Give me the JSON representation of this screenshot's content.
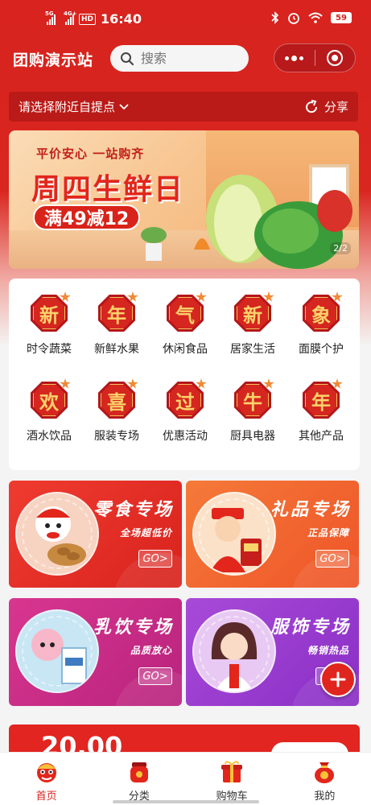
{
  "status_bar": {
    "time": "16:40",
    "signal1_label": "5G",
    "signal2_label": "4G+",
    "hd_label": "HD",
    "battery": "59"
  },
  "header": {
    "title": "团购演示站",
    "search_placeholder": "搜索"
  },
  "pickup": {
    "label": "请选择附近自提点",
    "share_label": "分享"
  },
  "banner": {
    "tagline": "平价安心 一站购齐",
    "headline": "周四生鲜日",
    "promo": "满49减12",
    "pager": "2/2"
  },
  "categories": [
    {
      "char": "新",
      "label": "时令蔬菜"
    },
    {
      "char": "年",
      "label": "新鲜水果"
    },
    {
      "char": "气",
      "label": "休闲食品"
    },
    {
      "char": "新",
      "label": "居家生活"
    },
    {
      "char": "象",
      "label": "面膜个护"
    },
    {
      "char": "欢",
      "label": "酒水饮品"
    },
    {
      "char": "喜",
      "label": "服装专场"
    },
    {
      "char": "过",
      "label": "优惠活动"
    },
    {
      "char": "牛",
      "label": "厨具电器"
    },
    {
      "char": "年",
      "label": "其他产品"
    }
  ],
  "promo_cards": [
    {
      "title": "零食专场",
      "subtitle": "全场超低价",
      "go": "GO>",
      "color": "#e52a25"
    },
    {
      "title": "礼品专场",
      "subtitle": "正品保障",
      "go": "GO>",
      "color": "#f0602c"
    },
    {
      "title": "乳饮专场",
      "subtitle": "品质放心",
      "go": "GO>",
      "color": "#c12c8a"
    },
    {
      "title": "服饰专场",
      "subtitle": "畅销热品",
      "go": "GO>",
      "color": "#9b3ad0"
    }
  ],
  "coupon": {
    "amount": "20.00"
  },
  "tabbar": [
    {
      "label": "首页",
      "icon": "lion-dance-icon",
      "active": true
    },
    {
      "label": "分类",
      "icon": "red-envelope-jar-icon",
      "active": false
    },
    {
      "label": "购物车",
      "icon": "gift-box-icon",
      "active": false
    },
    {
      "label": "我的",
      "icon": "money-bag-icon",
      "active": false
    }
  ],
  "colors": {
    "brand_red": "#d8231e",
    "gold": "#fcd26a"
  }
}
